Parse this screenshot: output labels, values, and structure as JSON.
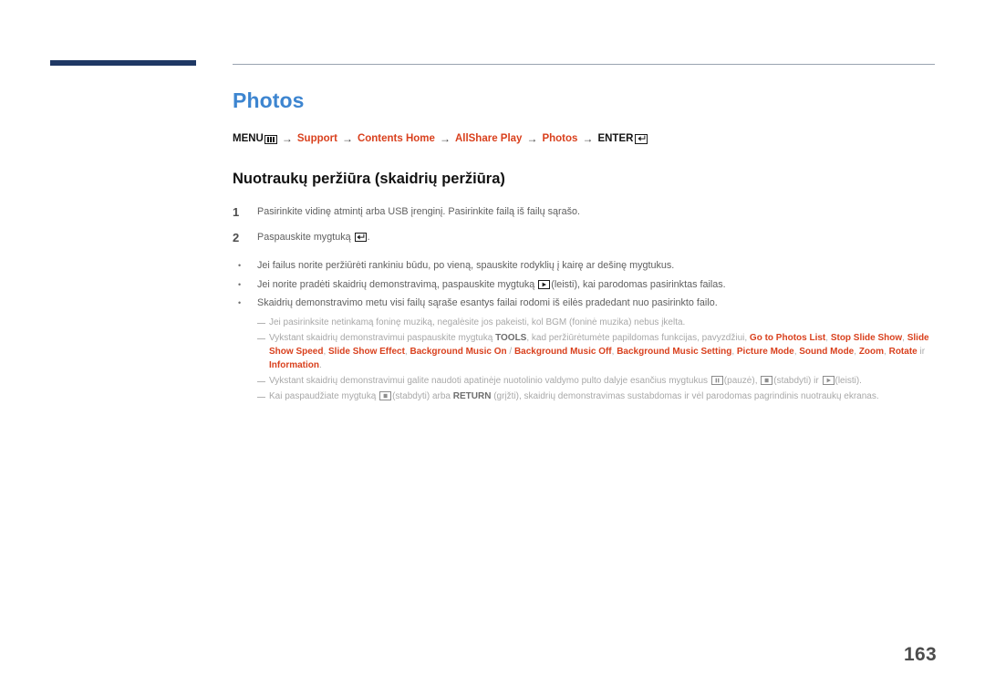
{
  "document": {
    "chapter_title": "Photos",
    "page_number": "163",
    "accent_title_color": "#3d85d0",
    "accent_link_color": "#d9411e",
    "rule_color": "#1f3864"
  },
  "breadcrumb": {
    "name": "menu-path",
    "items": [
      {
        "label": "MENU",
        "style": "dark",
        "icon": "menu-icon"
      },
      {
        "label": "Support",
        "style": "red",
        "icon": ""
      },
      {
        "label": "Contents Home",
        "style": "red",
        "icon": ""
      },
      {
        "label": "AllShare Play",
        "style": "red",
        "icon": ""
      },
      {
        "label": "Photos",
        "style": "red",
        "icon": ""
      },
      {
        "label": "ENTER",
        "style": "dark",
        "icon": "enter-icon"
      }
    ],
    "separator": "→"
  },
  "section": {
    "title": "Nuotraukų peržiūra (skaidrių peržiūra)"
  },
  "steps": [
    {
      "number": "1",
      "text": "Pasirinkite vidinę atmintį arba USB įrenginį. Pasirinkite failą iš failų sąrašo."
    },
    {
      "number": "2",
      "text_before": "Paspauskite mygtuką ",
      "icon": "enter-icon",
      "text_after": "."
    }
  ],
  "bullets": [
    {
      "marker": "•",
      "text": "Jei failus norite peržiūrėti rankiniu būdu, po vieną, spauskite rodyklių į kairę ar dešinę mygtukus."
    },
    {
      "marker": "•",
      "text_before": "Jei norite pradėti skaidrių demonstravimą, paspauskite mygtuką ",
      "icon": "play-icon",
      "text_after": "(leisti), kai parodomas pasirinktas failas."
    },
    {
      "marker": "•",
      "text": "Skaidrių demonstravimo metu visi failų sąraše esantys failai rodomi iš eilės pradedant nuo pasirinkto failo."
    }
  ],
  "notes": [
    {
      "id": "note-bgm",
      "text": "Jei pasirinksite netinkamą foninę muziką, negalėsite jos pakeisti, kol BGM (foninė muzika) nebus įkelta."
    },
    {
      "id": "note-tools",
      "text_1": "Vykstant skaidrių demonstravimui paspauskite mygtuką ",
      "bold_1": "TOOLS",
      "text_2": ", kad peržiūrėtumėte papildomas funkcijas, pavyzdžiui, ",
      "menu_items": [
        "Go to Photos List",
        "Stop Slide Show",
        "Slide Show Speed",
        "Slide Show Effect",
        "Background Music On",
        "Background Music Off",
        "Background Music Setting",
        "Picture Mode",
        "Sound Mode",
        "Zoom",
        "Rotate",
        "Information"
      ],
      "slash_separator": " / ",
      "conjunction": " ir ",
      "terminator": "."
    },
    {
      "id": "note-remote",
      "text_1": "Vykstant skaidrių demonstravimui galite naudoti apatinėje nuotolinio valdymo pulto dalyje esančius mygtukus ",
      "icon_1": "pause-icon",
      "text_2": "(pauzė), ",
      "icon_2": "stop-icon",
      "text_3": "(stabdyti) ir ",
      "icon_3": "play-icon",
      "text_4": "(leisti)."
    },
    {
      "id": "note-return",
      "text_1": "Kai paspaudžiate mygtuką ",
      "icon_1": "stop-icon",
      "text_2": "(stabdyti) arba ",
      "bold_1": "RETURN",
      "text_3": " (grįžti), skaidrių demonstravimas sustabdomas ir vėl parodomas pagrindinis nuotraukų ekranas."
    }
  ]
}
